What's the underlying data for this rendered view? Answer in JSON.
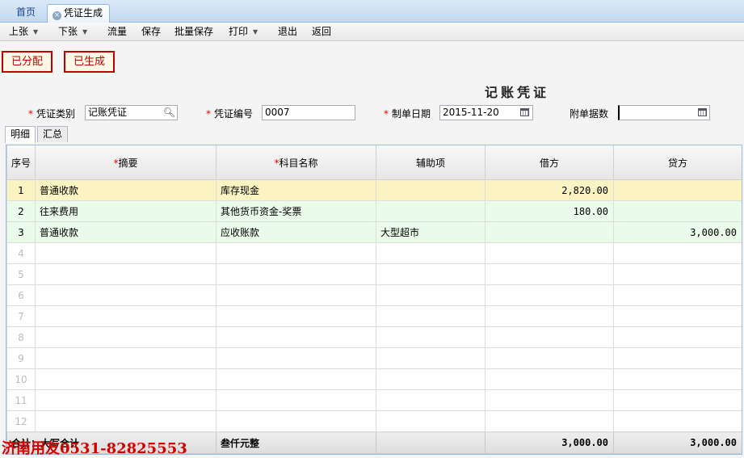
{
  "tabs": {
    "home": "首页",
    "active": "凭证生成"
  },
  "toolbar": {
    "prev": "上张",
    "next": "下张",
    "flow": "流量",
    "save": "保存",
    "batch_save": "批量保存",
    "print": "打印",
    "exit": "退出",
    "back": "返回"
  },
  "status": {
    "allocated": "已分配",
    "generated": "已生成"
  },
  "voucher": {
    "title": "记账凭证",
    "type_label": "凭证类别",
    "type_value": "记账凭证",
    "number_label": "凭证编号",
    "number_value": "0007",
    "date_label": "制单日期",
    "date_value": "2015-11-20",
    "attachments_label": "附单据数",
    "attachments_value": ""
  },
  "detail_tabs": {
    "detail": "明细",
    "summary": "汇总"
  },
  "grid": {
    "headers": {
      "seq": "序号",
      "summary": "摘要",
      "account": "科目名称",
      "aux": "辅助项",
      "debit": "借方",
      "credit": "贷方"
    },
    "rows": [
      {
        "seq": "1",
        "summary": "普通收款",
        "account": "库存现金",
        "aux": "",
        "debit": "2,820.00",
        "credit": ""
      },
      {
        "seq": "2",
        "summary": "往来费用",
        "account": "其他货币资金-奖票",
        "aux": "",
        "debit": "180.00",
        "credit": ""
      },
      {
        "seq": "3",
        "summary": "普通收款",
        "account": "应收账款",
        "aux": "大型超市",
        "debit": "",
        "credit": "3,000.00"
      },
      {
        "seq": "4"
      },
      {
        "seq": "5"
      },
      {
        "seq": "6"
      },
      {
        "seq": "7"
      },
      {
        "seq": "8"
      },
      {
        "seq": "9"
      },
      {
        "seq": "10"
      },
      {
        "seq": "11"
      },
      {
        "seq": "12"
      }
    ],
    "total": {
      "label": "合计：大写合计",
      "amount_words": "叁仟元整",
      "debit": "3,000.00",
      "credit": "3,000.00"
    }
  },
  "watermark": "济南用友0531-82825553"
}
